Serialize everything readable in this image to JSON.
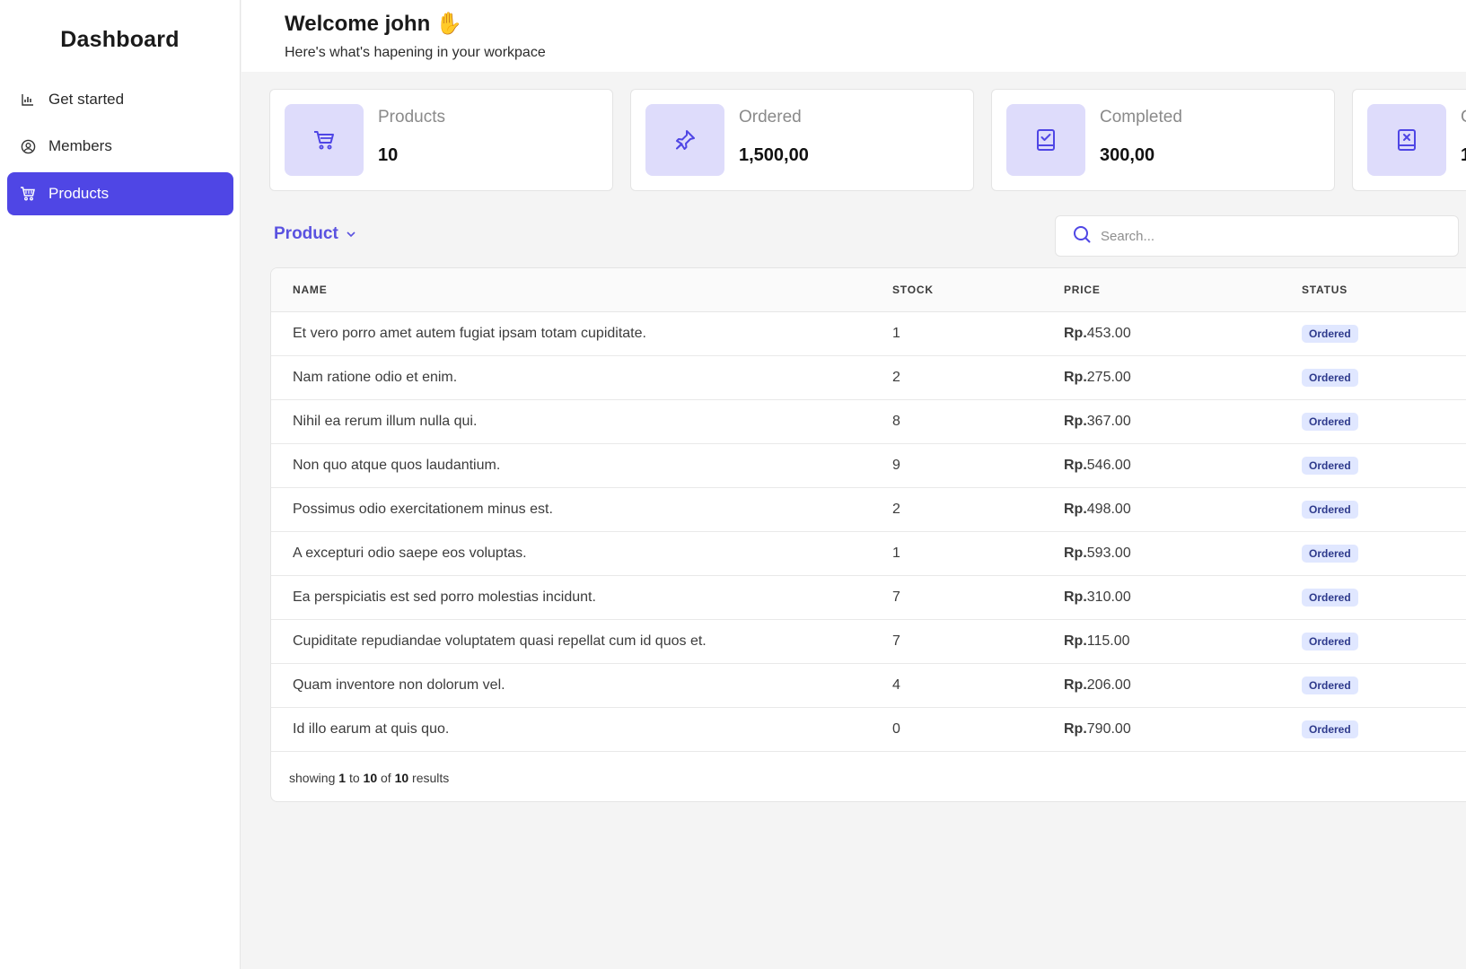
{
  "sidebar": {
    "brand": "Dashboard",
    "items": [
      {
        "label": "Get started",
        "icon": "bar-chart-icon"
      },
      {
        "label": "Members",
        "icon": "user-circle-icon"
      },
      {
        "label": "Products",
        "icon": "shopping-cart-icon",
        "active": true
      }
    ]
  },
  "header": {
    "welcome": "Welcome john",
    "hand": "✋",
    "subtitle": "Here's what's hapening in your workpace"
  },
  "cards": [
    {
      "label": "Products",
      "value": "10",
      "icon": "cart-icon"
    },
    {
      "label": "Ordered",
      "value": "1,500,00",
      "icon": "pin-icon"
    },
    {
      "label": "Completed",
      "value": "300,00",
      "icon": "check-book-icon"
    },
    {
      "label": "C",
      "value": "1",
      "icon": "x-book-icon"
    }
  ],
  "filter": {
    "label": "Product"
  },
  "search": {
    "placeholder": "Search..."
  },
  "table": {
    "columns": [
      "NAME",
      "STOCK",
      "PRICE",
      "STATUS"
    ],
    "currency": "Rp.",
    "rows": [
      {
        "name": "Et vero porro amet autem fugiat ipsam totam cupiditate.",
        "stock": "1",
        "price": "453.00",
        "status": "Ordered"
      },
      {
        "name": "Nam ratione odio et enim.",
        "stock": "2",
        "price": "275.00",
        "status": "Ordered"
      },
      {
        "name": "Nihil ea rerum illum nulla qui.",
        "stock": "8",
        "price": "367.00",
        "status": "Ordered"
      },
      {
        "name": "Non quo atque quos laudantium.",
        "stock": "9",
        "price": "546.00",
        "status": "Ordered"
      },
      {
        "name": "Possimus odio exercitationem minus est.",
        "stock": "2",
        "price": "498.00",
        "status": "Ordered"
      },
      {
        "name": "A excepturi odio saepe eos voluptas.",
        "stock": "1",
        "price": "593.00",
        "status": "Ordered"
      },
      {
        "name": "Ea perspiciatis est sed porro molestias incidunt.",
        "stock": "7",
        "price": "310.00",
        "status": "Ordered"
      },
      {
        "name": "Cupiditate repudiandae voluptatem quasi repellat cum id quos et.",
        "stock": "7",
        "price": "115.00",
        "status": "Ordered"
      },
      {
        "name": "Quam inventore non dolorum vel.",
        "stock": "4",
        "price": "206.00",
        "status": "Ordered"
      },
      {
        "name": "Id illo earum at quis quo.",
        "stock": "0",
        "price": "790.00",
        "status": "Ordered"
      }
    ],
    "footer": {
      "prefix": "showing",
      "from": "1",
      "to_word": "to",
      "to": "10",
      "of_word": "of",
      "total": "10",
      "suffix": "results"
    }
  },
  "colors": {
    "accent": "#4f46e5",
    "icon_bg": "#dedcfb",
    "badge_bg": "#e0e7ff"
  }
}
